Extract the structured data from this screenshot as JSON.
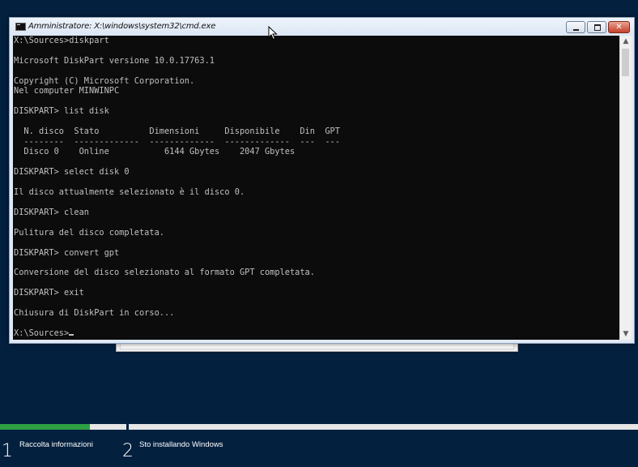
{
  "window": {
    "title": "Amministratore: X:\\windows\\system32\\cmd.exe",
    "min_label": "",
    "max_label": "",
    "close_label": "✕"
  },
  "console": {
    "lines": [
      "X:\\Sources>diskpart",
      "",
      "Microsoft DiskPart versione 10.0.17763.1",
      "",
      "Copyright (C) Microsoft Corporation.",
      "Nel computer MINWINPC",
      "",
      "DISKPART> list disk",
      "",
      "  N. disco  Stato          Dimensioni     Disponibile    Din  GPT",
      "  --------  -------------  -------------  -------------  ---  ---",
      "  Disco 0    Online           6144 Gbytes    2047 Gbytes",
      "",
      "DISKPART> select disk 0",
      "",
      "Il disco attualmente selezionato è il disco 0.",
      "",
      "DISKPART> clean",
      "",
      "Pulitura del disco completata.",
      "",
      "DISKPART> convert gpt",
      "",
      "Conversione del disco selezionato al formato GPT completata.",
      "",
      "DISKPART> exit",
      "",
      "Chiusura di DiskPart in corso...",
      ""
    ],
    "prompt": "X:\\Sources>"
  },
  "scrollbar": {
    "up_icon": "▲",
    "down_icon": "▼"
  },
  "progress": {
    "step1_fill": 0.71,
    "fill_color": "#2ea043"
  },
  "steps": [
    {
      "number": "1",
      "label": "Raccolta informazioni"
    },
    {
      "number": "2",
      "label": "Sto installando Windows"
    }
  ],
  "colors": {
    "background": "#03203f",
    "console_bg": "#0c0c0c",
    "console_text": "#c0c0c0"
  }
}
